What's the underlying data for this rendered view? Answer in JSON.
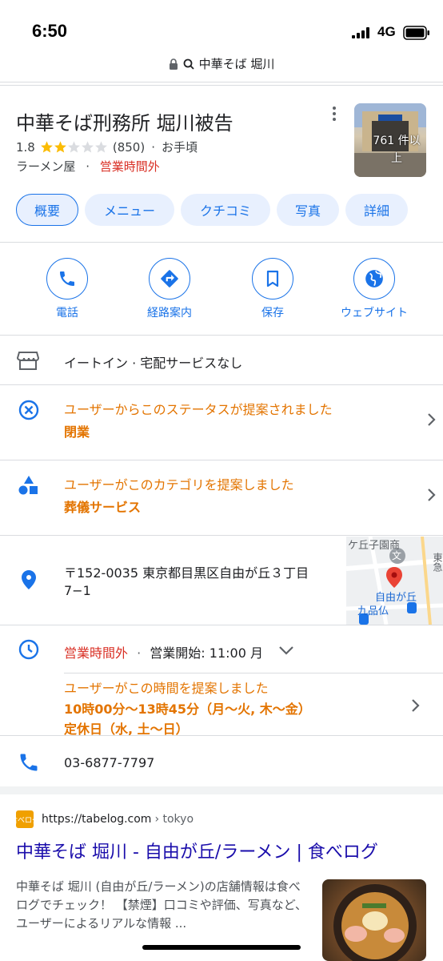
{
  "status": {
    "time": "6:50",
    "network": "4G"
  },
  "url": {
    "query": "中華そば 堀川"
  },
  "place": {
    "name": "中華そば刑務所 堀川被告",
    "rating": "1.8",
    "stars": 2,
    "reviews": "(850)",
    "price": "お手頃",
    "category": "ラーメン屋",
    "open_status": "営業時間外",
    "photo_count": "761 件以上"
  },
  "tabs": [
    {
      "label": "概要"
    },
    {
      "label": "メニュー"
    },
    {
      "label": "クチコミ"
    },
    {
      "label": "写真"
    },
    {
      "label": "詳細"
    }
  ],
  "actions": [
    {
      "label": "電話",
      "icon": "phone-icon"
    },
    {
      "label": "経路案内",
      "icon": "directions-icon"
    },
    {
      "label": "保存",
      "icon": "bookmark-icon"
    },
    {
      "label": "ウェブサイト",
      "icon": "globe-icon"
    }
  ],
  "service": {
    "text": "イートイン · 宅配サービスなし"
  },
  "status_suggest": {
    "line1": "ユーザーからこのステータスが提案されました",
    "line2": "閉業"
  },
  "category_suggest": {
    "line1": "ユーザーがこのカテゴリを提案しました",
    "line2": "葬儀サービス"
  },
  "address": {
    "line1": "〒152-0035 東京都目黒区自由が丘３丁目",
    "line2": "7−1"
  },
  "map": {
    "labels": [
      "ケ丘子園商",
      "文",
      "自由が丘",
      "九品仏",
      "東急"
    ]
  },
  "hours": {
    "closed": "営業時間外",
    "opens": "営業開始: 11:00 月",
    "suggest": "ユーザーがこの時間を提案しました",
    "line1": "10時00分〜13時45分（月〜火, 木〜金）",
    "line2": "定休日（水, 土〜日）"
  },
  "phone": {
    "number": "03-6877-7797"
  },
  "snippet": {
    "favicon": "食べログ",
    "site": "https://tabelog.com",
    "path": "› tokyo",
    "title": "中華そば 堀川 - 自由が丘/ラーメン | 食べログ",
    "body": "中華そば 堀川 (自由が丘/ラーメン)の店舗情報は食べログでチェック！ 【禁煙】口コミや評価、写真など、ユーザーによるリアルな情報 ..."
  },
  "colors": {
    "accent": "#1a73e8",
    "warning": "#e37400",
    "closed": "#d93025"
  }
}
